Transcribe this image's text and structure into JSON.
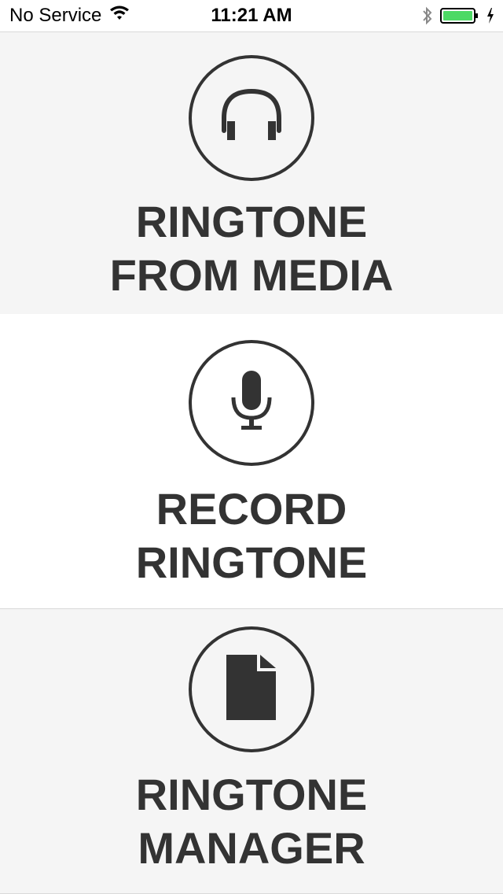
{
  "status": {
    "carrier": "No Service",
    "time": "11:21 AM"
  },
  "menu": {
    "items": [
      {
        "icon": "headphones-icon",
        "line1": "RINGTONE",
        "line2": "FROM MEDIA"
      },
      {
        "icon": "microphone-icon",
        "line1": "RECORD",
        "line2": "RINGTONE"
      },
      {
        "icon": "document-icon",
        "line1": "RINGTONE",
        "line2": "MANAGER"
      }
    ]
  },
  "colors": {
    "foreground": "#333333",
    "panel_gray": "#f5f5f5",
    "panel_white": "#ffffff",
    "battery_green": "#4cd964"
  }
}
